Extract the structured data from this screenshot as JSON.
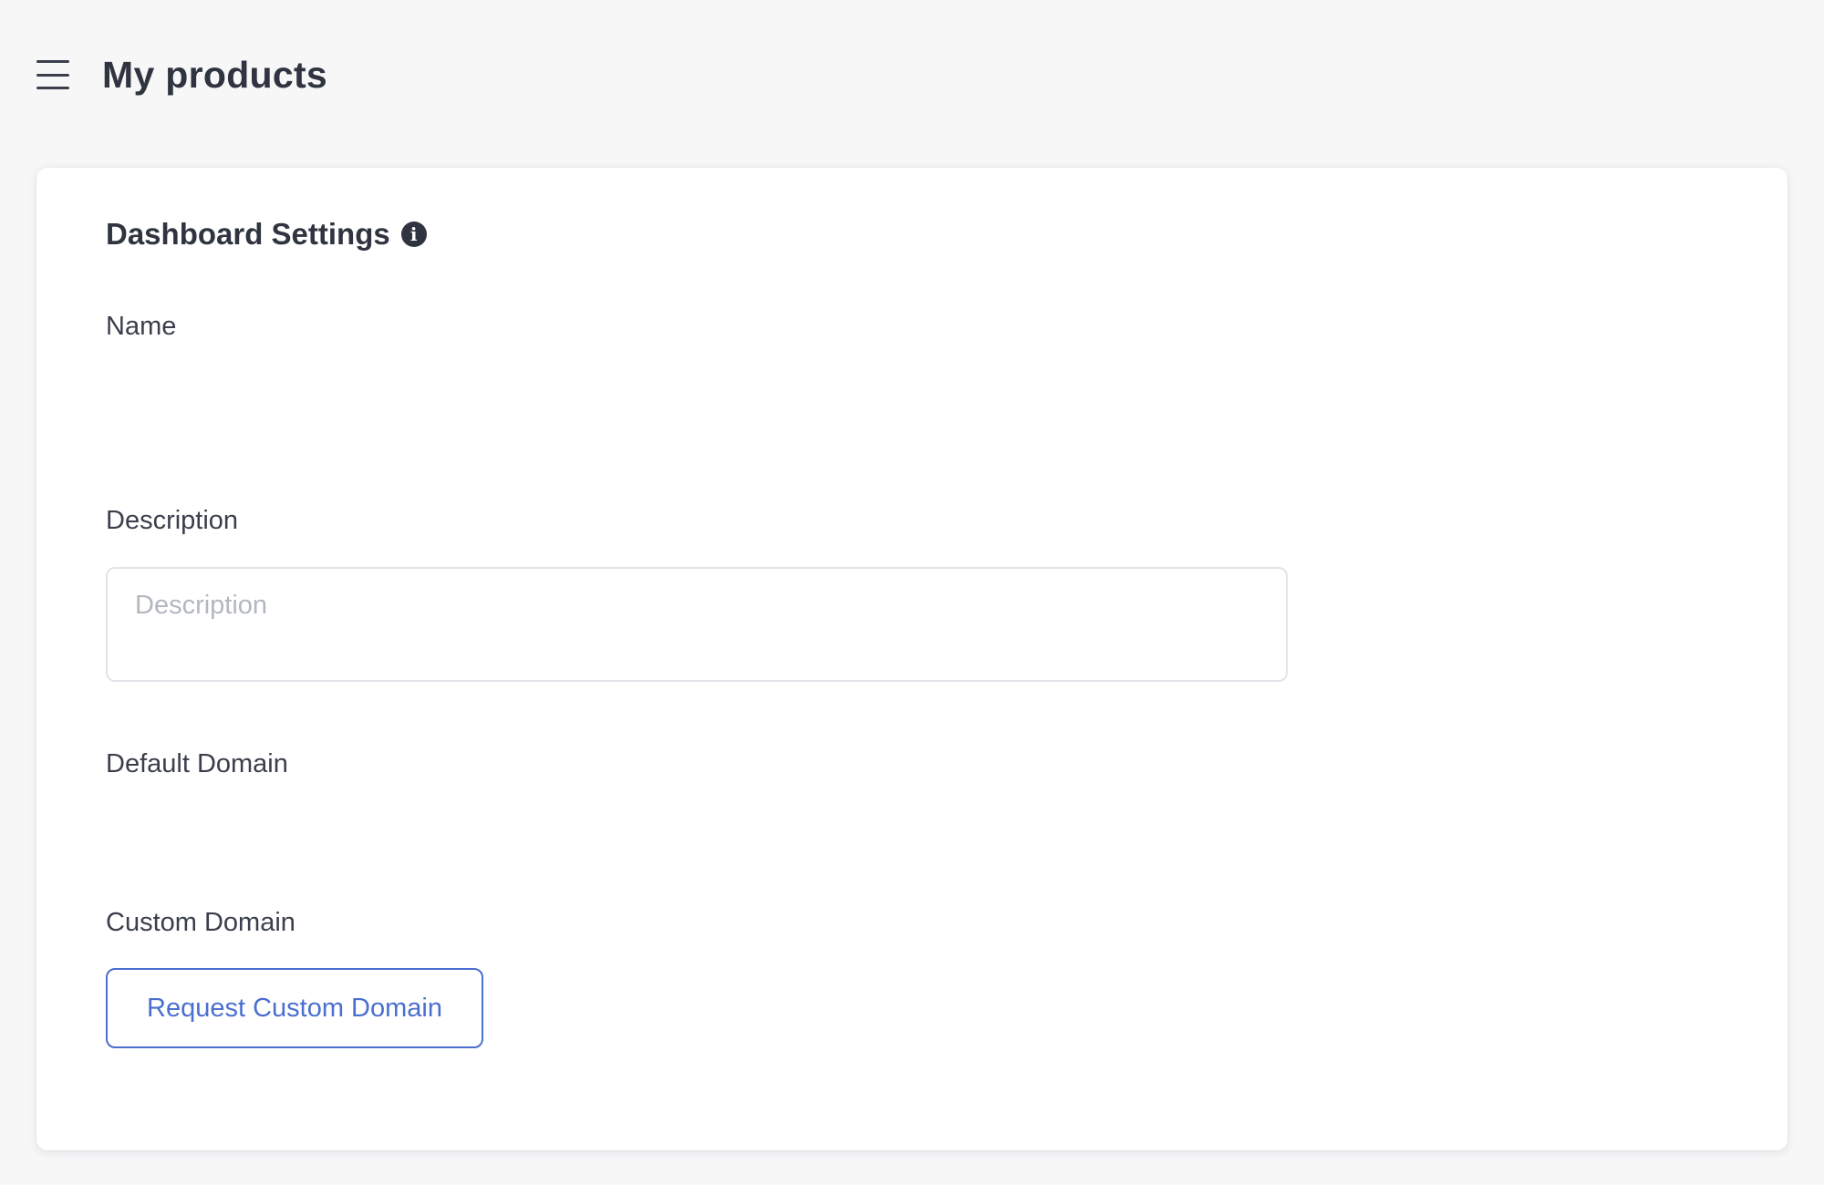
{
  "header": {
    "menu_icon": "hamburger-menu-icon",
    "title": "My products"
  },
  "card": {
    "title": "Dashboard Settings",
    "info_icon": "info-circle-icon",
    "info_glyph": "i",
    "fields": {
      "name_label": "Name",
      "description_label": "Description",
      "description_placeholder": "Description",
      "default_domain_label": "Default Domain",
      "custom_domain_label": "Custom Domain"
    },
    "request_button_label": "Request Custom Domain"
  },
  "colors": {
    "accent": "#4a6fcf",
    "text": "#2f3440",
    "input_border": "#e2e4e9",
    "placeholder": "#b3b7c0"
  }
}
